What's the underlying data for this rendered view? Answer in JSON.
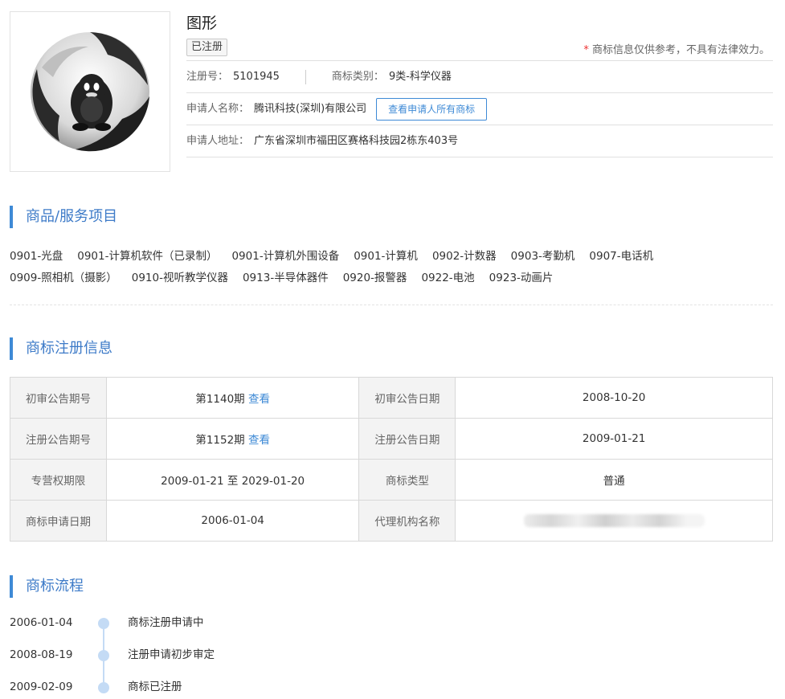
{
  "trademark": {
    "name": "图形",
    "status_badge": "已注册",
    "disclaimer_star": "*",
    "disclaimer": "商标信息仅供参考，不具有法律效力。",
    "reg_no_label": "注册号：",
    "reg_no": "5101945",
    "category_label": "商标类别：",
    "category": "9类-科学仪器",
    "applicant_label": "申请人名称：",
    "applicant": "腾讯科技(深圳)有限公司",
    "view_all_button": "查看申请人所有商标",
    "address_label": "申请人地址：",
    "address": "广东省深圳市福田区赛格科技园2栋东403号",
    "logo_icon": "qq-penguin-circle-logo"
  },
  "goods_section": {
    "heading": "商品/服务项目",
    "line1": [
      "0901-光盘",
      "0901-计算机软件（已录制）",
      "0901-计算机外围设备",
      "0901-计算机",
      "0902-计数器",
      "0903-考勤机",
      "0907-电话机"
    ],
    "line2": [
      "0909-照相机（摄影）",
      "0910-视听教学仪器",
      "0913-半导体器件",
      "0920-报警器",
      "0922-电池",
      "0923-动画片"
    ]
  },
  "registration": {
    "heading": "商标注册信息",
    "prelim_issue_label": "初审公告期号",
    "prelim_issue": "第1140期",
    "prelim_issue_link": "查看",
    "prelim_date_label": "初审公告日期",
    "prelim_date": "2008-10-20",
    "reg_issue_label": "注册公告期号",
    "reg_issue": "第1152期",
    "reg_issue_link": "查看",
    "reg_date_label": "注册公告日期",
    "reg_date": "2009-01-21",
    "term_label": "专营权期限",
    "term": "2009-01-21 至 2029-01-20",
    "type_label": "商标类型",
    "type": "普通",
    "apply_date_label": "商标申请日期",
    "apply_date": "2006-01-04",
    "agent_label": "代理机构名称"
  },
  "flow": {
    "heading": "商标流程",
    "steps": [
      {
        "date": "2006-01-04",
        "text": "商标注册申请中"
      },
      {
        "date": "2008-08-19",
        "text": "注册申请初步审定"
      },
      {
        "date": "2009-02-09",
        "text": "商标已注册"
      }
    ]
  },
  "colors": {
    "accent": "#3e8ad6",
    "heading": "#3e7bc8",
    "timeline": "#c4dbf5"
  }
}
